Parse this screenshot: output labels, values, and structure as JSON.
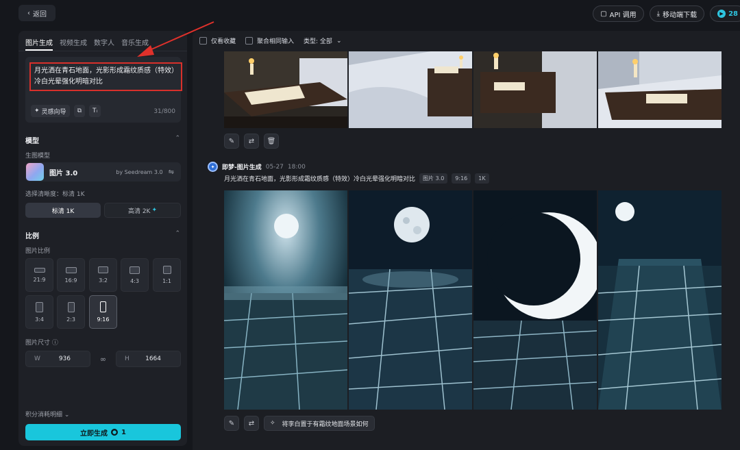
{
  "topbar": {
    "back_label": "返回",
    "api_label": "API 调用",
    "download_label": "移动端下载",
    "credits": "28"
  },
  "panel": {
    "tabs": [
      {
        "label": "图片生成",
        "active": true
      },
      {
        "label": "视频生成",
        "active": false
      },
      {
        "label": "数字人",
        "active": false
      },
      {
        "label": "音乐生成",
        "active": false
      }
    ],
    "prompt": {
      "text": "月光洒在青石地面，光影形成霜纹质感（特效）冷白光晕强化明暗对比",
      "count": "31/800",
      "inspire_label": "灵感向导"
    },
    "model": {
      "section_title": "模型",
      "sub_label": "生图模型",
      "name": "图片 3.0",
      "by": "by Seedream 3.0"
    },
    "resolution": {
      "label": "选择清晰度：标清 1K",
      "options": [
        "标清 1K",
        "高清 2K"
      ]
    },
    "ratio": {
      "section_title": "比例",
      "sub_label": "图片比例",
      "options": [
        "21:9",
        "16:9",
        "3:2",
        "4:3",
        "1:1",
        "3:4",
        "2:3",
        "9:16"
      ],
      "selected": "9:16"
    },
    "size": {
      "label": "图片尺寸",
      "w_key": "W",
      "w_value": "936",
      "h_key": "H",
      "h_value": "1664"
    },
    "credit_detail": "积分消耗明细",
    "generate": {
      "label": "立即生成",
      "cost": "1"
    }
  },
  "main": {
    "filters": {
      "fav_label": "仅看收藏",
      "merge_label": "聚合相同输入",
      "type_label": "类型: 全部"
    },
    "generation": {
      "author": "即梦-图片生成",
      "date": "05-27",
      "time": "18:00",
      "prompt": "月光洒在青石地面，光影形成霜纹质感（特效）冷白光晕强化明暗对比",
      "tags": [
        "图片 3.0",
        "9:16",
        "1K"
      ],
      "suggestion": "将李白置于有霜纹地面场景如何"
    }
  },
  "colors": {
    "accent": "#19c6dc",
    "highlight_border": "#d9302b",
    "background": "#15171c"
  }
}
